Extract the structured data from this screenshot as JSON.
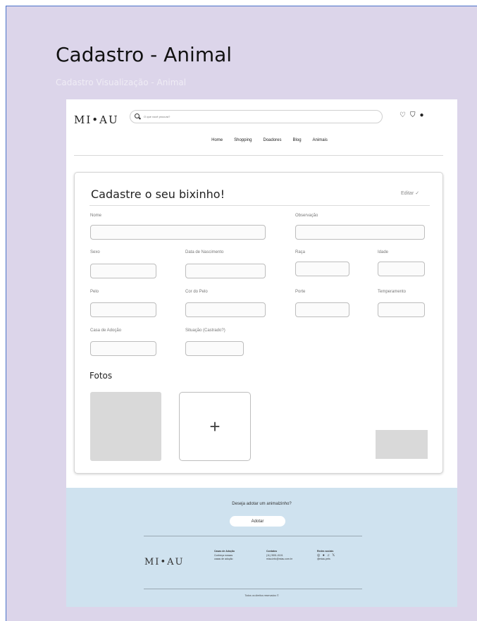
{
  "frame": {
    "title": "Cadastro - Animal",
    "subtitle": "Cadastro  Visualização - Animal",
    "background": "#dcd5ea"
  },
  "header": {
    "logo": "MI•AU",
    "search_placeholder": "O que você procura?",
    "icons": [
      "heart-icon",
      "shopping-bag-icon",
      "user-icon"
    ],
    "nav": [
      "Home",
      "Shopping",
      "Doadores",
      "Blog",
      "Animais"
    ]
  },
  "form": {
    "title": "Cadastre o seu bixinho!",
    "edit_label": "Editar ✓",
    "fields": {
      "nome": "Nome",
      "observacao": "Observação",
      "sexo": "Sexo",
      "data_nascimento": "Data de Nascimento",
      "raca": "Raça",
      "idade": "Idade",
      "pelo": "Pelo",
      "cor_pelo": "Cor do Pelo",
      "porte": "Porte",
      "temperamento": "Temperamento",
      "casa_adocao": "Casa de Adoção",
      "situacao": "Situação (Castrado?)"
    },
    "fotos_title": "Fotos",
    "add_photo_symbol": "+"
  },
  "footer": {
    "background": "#cfe2ef",
    "cta_text": "Deseja adotar um animalzinho?",
    "cta_button": "Adotar",
    "logo": "MI•AU",
    "col1": {
      "title": "Casas de Adoção",
      "lines": [
        "Conheça nossas",
        "casas de adoção"
      ]
    },
    "col2": {
      "title": "Contatos",
      "lines": [
        "(11) 3501-0101",
        "miau.info@miau.com.br"
      ]
    },
    "col3": {
      "title": "Redes sociais",
      "icons": "◎ ● ♫ 𝕏",
      "handle": "@miau.pets"
    },
    "copyright": "Todos os direitos reservados ©"
  }
}
